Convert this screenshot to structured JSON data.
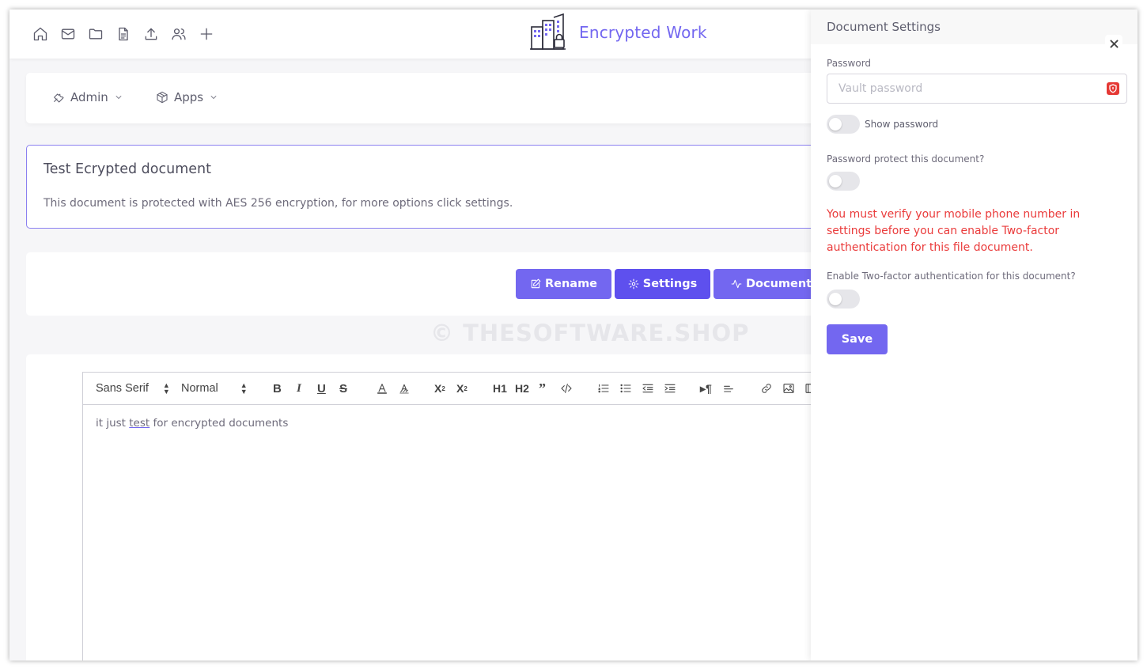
{
  "header": {
    "brand_name": "Encrypted Work",
    "nav_icons": [
      "home-icon",
      "mail-icon",
      "folder-icon",
      "file-icon",
      "upload-icon",
      "users-icon",
      "plus-icon"
    ]
  },
  "menu": {
    "admin_label": "Admin",
    "apps_label": "Apps"
  },
  "info": {
    "title": "Test Ecrypted document",
    "text": "This document is protected with AES 256 encryption, for more options click settings."
  },
  "actions": {
    "rename_label": "Rename",
    "settings_label": "Settings",
    "document_label": "Document l"
  },
  "watermark": "© THESOFTWARE.SHOP",
  "editor": {
    "font_select": "Sans Serif",
    "size_select": "Normal",
    "h1": "H1",
    "h2": "H2",
    "text_before": "it just ",
    "text_underlined": "test",
    "text_after": " for encrypted documents"
  },
  "panel": {
    "title": "Document Settings",
    "password_label": "Password",
    "password_placeholder": "Vault password",
    "show_password_label": "Show password",
    "protect_label": "Password protect this document?",
    "warning": "You must verify your mobile phone number in settings before you can enable Two-factor authentication for this file document.",
    "twofa_label": "Enable Two-factor authentication for this document?",
    "save_label": "Save"
  },
  "colors": {
    "primary": "#7367f0",
    "settings_button": "#5e50ee",
    "warning": "#ea3b3b",
    "shield": "#e53935"
  }
}
